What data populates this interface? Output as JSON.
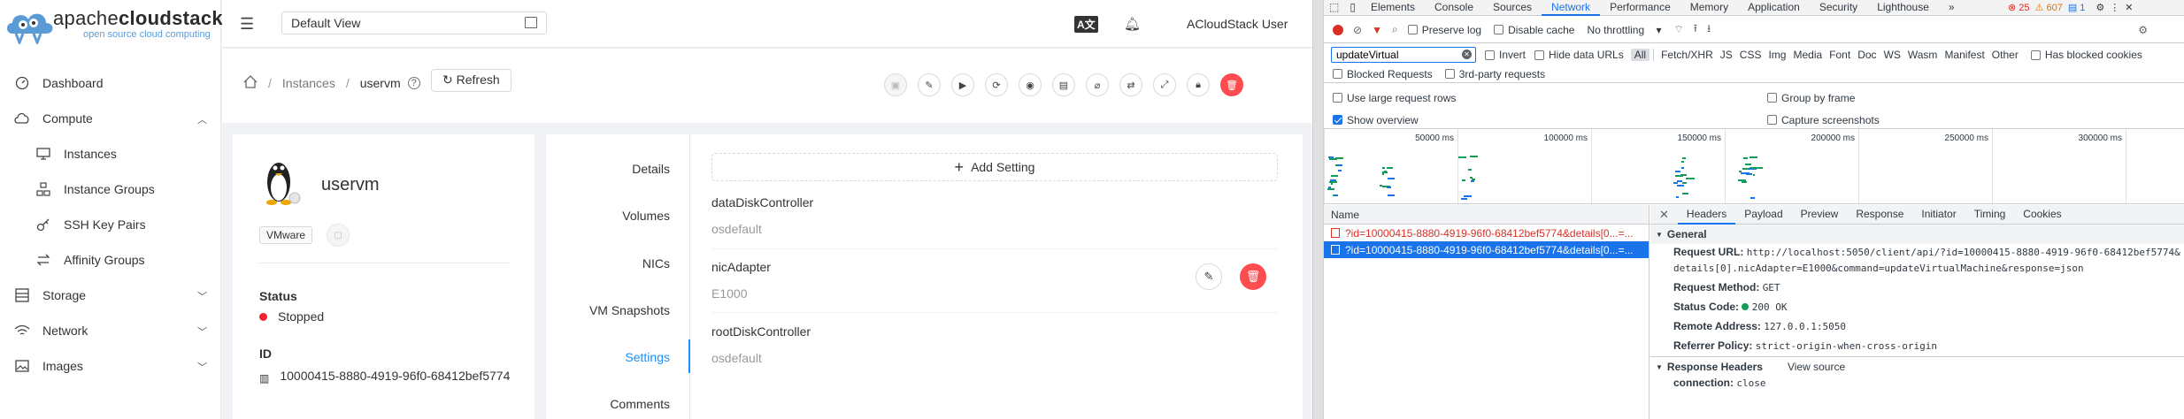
{
  "app": {
    "logo": {
      "brand_light": "apache",
      "brand_bold": "cloudstack",
      "tagline": "open source cloud computing"
    },
    "sidebar": {
      "items": [
        {
          "label": "Dashboard",
          "icon": "dashboard-icon"
        },
        {
          "label": "Compute",
          "icon": "desktop-icon",
          "expanded": true
        },
        {
          "label": "Instances",
          "icon": "monitor-icon"
        },
        {
          "label": "Instance Groups",
          "icon": "groups-icon"
        },
        {
          "label": "SSH Key Pairs",
          "icon": "key-icon"
        },
        {
          "label": "Affinity Groups",
          "icon": "swap-icon"
        },
        {
          "label": "Storage",
          "icon": "database-icon"
        },
        {
          "label": "Network",
          "icon": "wifi-icon"
        },
        {
          "label": "Images",
          "icon": "picture-icon"
        }
      ]
    },
    "header": {
      "project": "Default View",
      "user": "ACloudStack User"
    },
    "breadcrumb": {
      "home": "home-icon",
      "instances": "Instances",
      "current": "uservm",
      "refresh": "Refresh"
    },
    "vm": {
      "name": "uservm",
      "hypervisor": "VMware",
      "status_label": "Status",
      "status": "Stopped",
      "status_color": "#f5222d",
      "id_label": "ID",
      "id": "10000415-8880-4919-96f0-68412bef5774"
    },
    "tabs": [
      "Details",
      "Volumes",
      "NICs",
      "VM Snapshots",
      "Settings",
      "Comments"
    ],
    "active_tab": "Settings",
    "add_setting": "Add Setting",
    "settings": [
      {
        "key": "dataDiskController",
        "value": "osdefault"
      },
      {
        "key": "nicAdapter",
        "value": "E1000"
      },
      {
        "key": "rootDiskController",
        "value": "osdefault"
      }
    ],
    "accent": "#1890ff",
    "danger": "#ff4d4f"
  },
  "devtools": {
    "tabs": [
      "Elements",
      "Console",
      "Sources",
      "Network",
      "Performance",
      "Memory",
      "Application",
      "Security",
      "Lighthouse"
    ],
    "active": "Network",
    "errors": "25",
    "warnings": "607",
    "infos": "1",
    "preserve_log": "Preserve log",
    "disable_cache": "Disable cache",
    "throttling": "No throttling",
    "filter_value": "updateVirtual",
    "invert": "Invert",
    "hide_data_urls": "Hide data URLs",
    "filter_types": [
      "All",
      "Fetch/XHR",
      "JS",
      "CSS",
      "Img",
      "Media",
      "Font",
      "Doc",
      "WS",
      "Wasm",
      "Manifest",
      "Other"
    ],
    "has_blocked": "Has blocked cookies",
    "blocked_requests": "Blocked Requests",
    "third_party": "3rd-party requests",
    "large_rows": "Use large request rows",
    "group_by_frame": "Group by frame",
    "show_overview": "Show overview",
    "capture_screenshots": "Capture screenshots",
    "ticks": [
      "50000 ms",
      "100000 ms",
      "150000 ms",
      "200000 ms",
      "250000 ms",
      "300000 ms"
    ],
    "name_header": "Name",
    "requests": [
      {
        "name": "?id=10000415-8880-4919-96f0-68412bef5774&details[0...=...",
        "state": "error"
      },
      {
        "name": "?id=10000415-8880-4919-96f0-68412bef5774&details[0...=...",
        "state": "selected"
      }
    ],
    "detail_tabs": [
      "Headers",
      "Payload",
      "Preview",
      "Response",
      "Initiator",
      "Timing",
      "Cookies"
    ],
    "general_title": "General",
    "general": [
      {
        "k": "Request URL:",
        "v": "http://localhost:5050/client/api/?id=10000415-8880-4919-96f0-68412bef5774&"
      },
      {
        "k": "",
        "v": "details[0].nicAdapter=E1000&command=updateVirtualMachine&response=json"
      },
      {
        "k": "Request Method:",
        "v": "GET"
      },
      {
        "k": "Status Code:",
        "v": "200 OK"
      },
      {
        "k": "Remote Address:",
        "v": "127.0.0.1:5050"
      },
      {
        "k": "Referrer Policy:",
        "v": "strict-origin-when-cross-origin"
      }
    ],
    "response_headers_title": "Response Headers",
    "view_source": "View source",
    "response_headers": [
      {
        "k": "connection:",
        "v": "close"
      }
    ]
  }
}
